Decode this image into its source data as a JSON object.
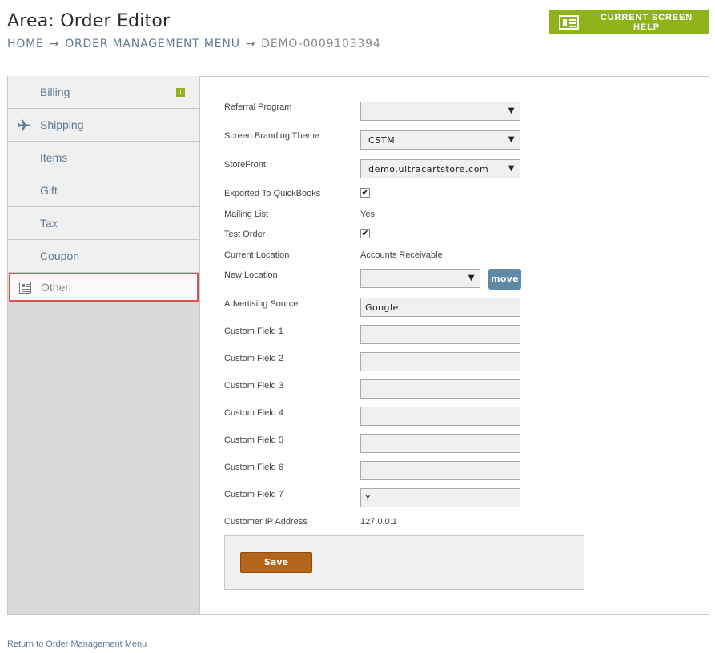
{
  "header": {
    "title": "Area: Order Editor",
    "breadcrumb": {
      "home": "HOME",
      "arrow": "→",
      "menu": "ORDER MANAGEMENT MENU",
      "current": "DEMO-0009103394"
    },
    "help_label": "CURRENT SCREEN HELP"
  },
  "sidebar": {
    "items": [
      {
        "label": "Billing",
        "icon": "info-badge-icon"
      },
      {
        "label": "Shipping",
        "icon": "airplane-icon"
      },
      {
        "label": "Items"
      },
      {
        "label": "Gift"
      },
      {
        "label": "Tax"
      },
      {
        "label": "Coupon"
      },
      {
        "label": "Other",
        "icon": "document-icon",
        "active": true
      }
    ],
    "badge_glyph": "i"
  },
  "form": {
    "referral_program": {
      "label": "Referral Program",
      "value": ""
    },
    "branding_theme": {
      "label": "Screen Branding Theme",
      "value": "CSTM"
    },
    "storefront": {
      "label": "StoreFront",
      "value": "demo.ultracartstore.com"
    },
    "exported_quickbooks": {
      "label": "Exported To QuickBooks",
      "checked": true
    },
    "mailing_list": {
      "label": "Mailing List",
      "value": "Yes"
    },
    "test_order": {
      "label": "Test Order",
      "checked": true
    },
    "current_location": {
      "label": "Current Location",
      "value": "Accounts Receivable"
    },
    "new_location": {
      "label": "New Location",
      "value": "",
      "button": "move"
    },
    "advertising_source": {
      "label": "Advertising Source",
      "value": "Google"
    },
    "custom_fields": [
      {
        "label": "Custom Field 1",
        "value": ""
      },
      {
        "label": "Custom Field 2",
        "value": ""
      },
      {
        "label": "Custom Field 3",
        "value": ""
      },
      {
        "label": "Custom Field 4",
        "value": ""
      },
      {
        "label": "Custom Field 5",
        "value": ""
      },
      {
        "label": "Custom Field 6",
        "value": ""
      },
      {
        "label": "Custom Field 7",
        "value": "Y"
      }
    ],
    "customer_ip": {
      "label": "Customer IP Address",
      "value": "127.0.0.1"
    },
    "check_glyph": "✔",
    "dropdown_glyph": "▼",
    "save_label": "Save"
  },
  "footer": {
    "return_link": "Return to Order Management Menu"
  },
  "colors": {
    "help_green": "#8fb31b",
    "link_blue": "#5f7b95",
    "move_button": "#5f8aa6",
    "save_button": "#b5641a",
    "active_border": "#d9534f"
  }
}
